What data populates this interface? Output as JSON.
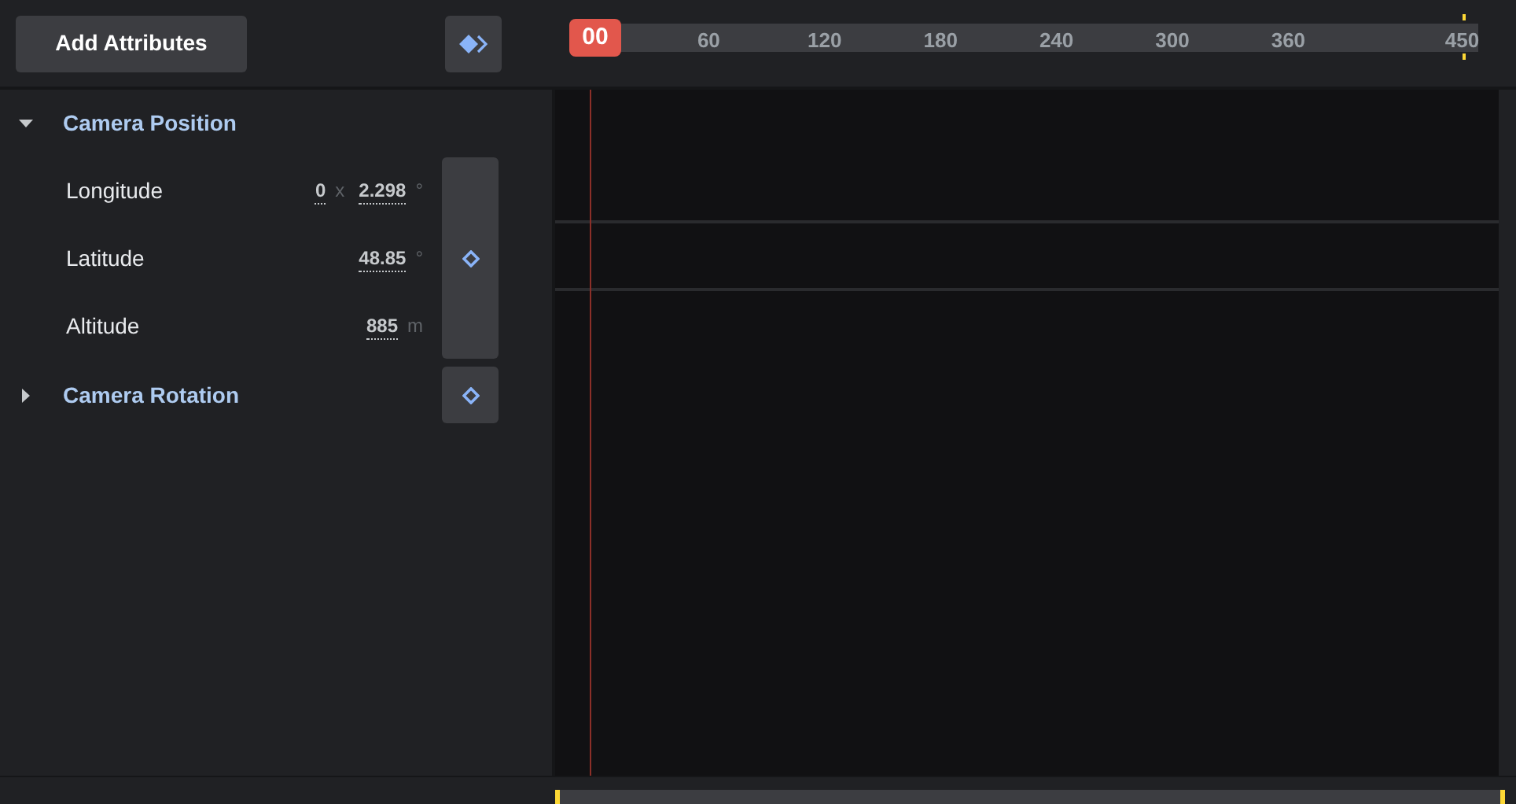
{
  "toolbar": {
    "add_button": "Add Attributes"
  },
  "timeline": {
    "playhead": "00",
    "ticks": [
      "60",
      "120",
      "180",
      "240",
      "300",
      "360",
      "450"
    ]
  },
  "groups": [
    {
      "label": "Camera Position",
      "expanded": true,
      "attributes": [
        {
          "label": "Longitude",
          "parts": [
            {
              "kind": "value",
              "text": "0"
            },
            {
              "kind": "unit",
              "text": "x"
            },
            {
              "kind": "value",
              "text": "2.298"
            },
            {
              "kind": "unit",
              "text": "°"
            }
          ]
        },
        {
          "label": "Latitude",
          "parts": [
            {
              "kind": "value",
              "text": "48.85"
            },
            {
              "kind": "unit",
              "text": "°"
            }
          ]
        },
        {
          "label": "Altitude",
          "parts": [
            {
              "kind": "value",
              "text": "885"
            },
            {
              "kind": "unit",
              "text": "m"
            }
          ]
        }
      ]
    },
    {
      "label": "Camera Rotation",
      "expanded": false
    }
  ]
}
